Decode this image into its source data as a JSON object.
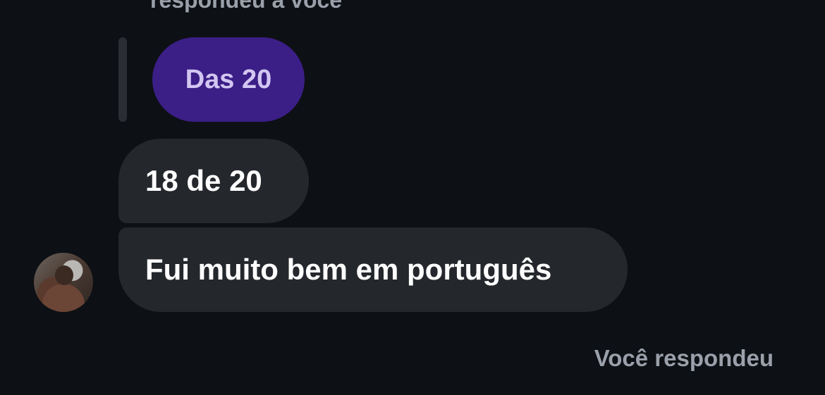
{
  "reply_context": {
    "header_text": "respondeu a você",
    "quoted_message": "Das 20"
  },
  "messages": [
    {
      "text": "18 de 20"
    },
    {
      "text": "Fui muito bem em português"
    }
  ],
  "sender": {
    "avatar_icon": "user-avatar"
  },
  "status": {
    "label": "Você respondeu"
  },
  "colors": {
    "background": "#0d1014",
    "incoming_bubble": "#24272c",
    "quoted_bubble": "#3b1e86",
    "quoted_text": "#d2c6f2",
    "muted_text": "#9aa0aa",
    "message_text": "#ffffff"
  }
}
